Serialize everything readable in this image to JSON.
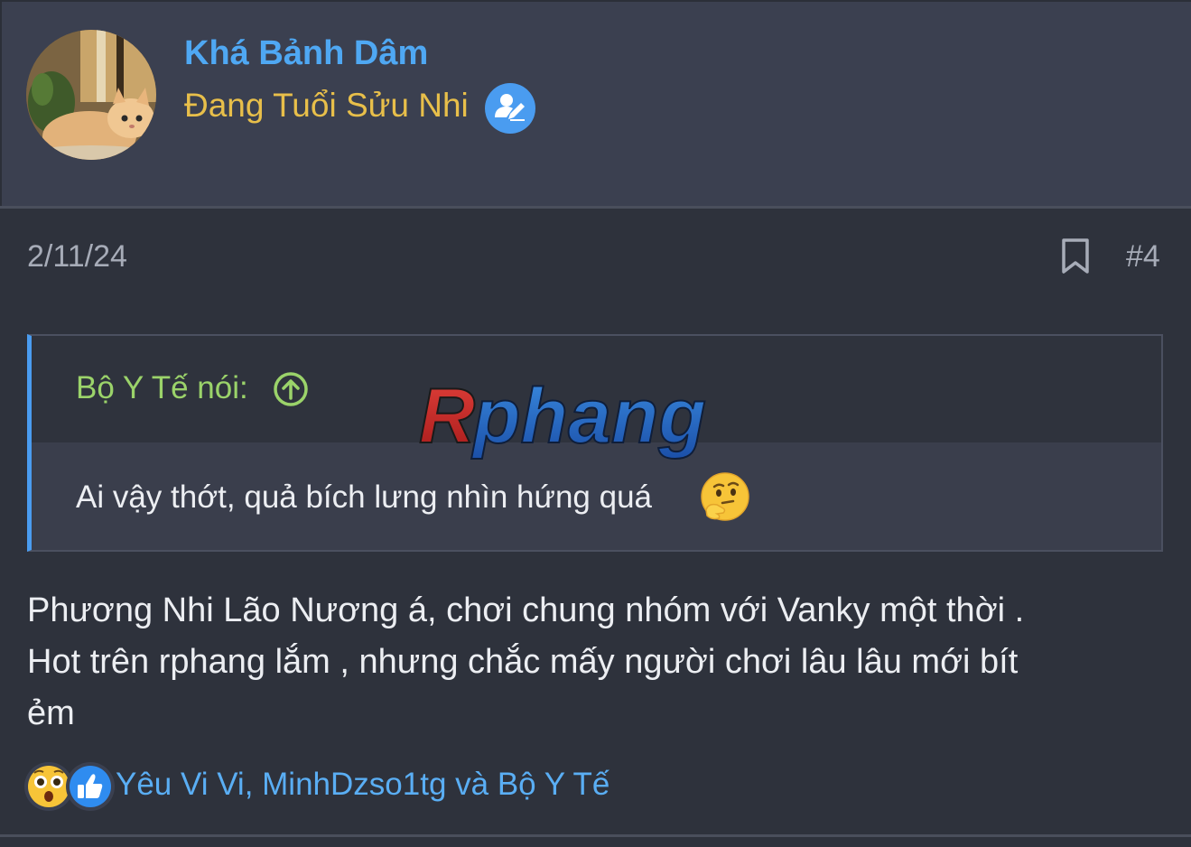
{
  "user": {
    "name": "Khá Bảnh Dâm",
    "title": "Đang Tuổi Sửu Nhi",
    "avatar_icon": "cat-photo-avatar",
    "badge_icon": "verified-user-icon"
  },
  "post": {
    "date": "2/11/24",
    "number": "#4",
    "bookmark_icon": "bookmark-icon",
    "body_lines": [
      "Phương Nhi Lão Nương á, chơi chung nhóm với Vanky một thời .",
      "Hot trên rphang lắm , nhưng chắc mấy người chơi lâu lâu mới bít",
      "ẻm"
    ]
  },
  "quote": {
    "author_label": "Bộ Y Tế nói:",
    "text": "Ai vậy thớt, quả bích lưng nhìn hứng quá",
    "emoji": "thinking-face"
  },
  "watermark": {
    "text": "Rphang"
  },
  "reactions": {
    "icons": [
      "astonished-face",
      "thumbs-up"
    ],
    "names": "Yêu Vi Vi, MinhDzso1tg và Bộ Y Tế"
  },
  "colors": {
    "username": "#4fa8f3",
    "user_title": "#e8bf4a",
    "quote_author": "#9bd36a",
    "accent_blue": "#4a9cf0"
  }
}
